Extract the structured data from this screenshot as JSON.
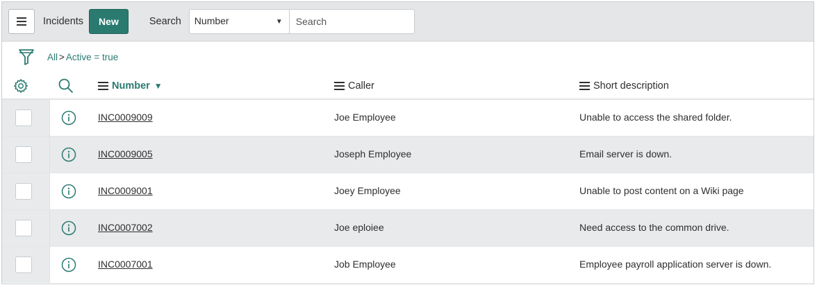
{
  "topbar": {
    "title": "Incidents",
    "new_label": "New",
    "search_label": "Search",
    "field_value": "Number",
    "search_placeholder": "Search"
  },
  "filter": {
    "crumb_all": "All",
    "separator": ">",
    "crumb_condition": "Active = true"
  },
  "columns": {
    "number": "Number",
    "caller": "Caller",
    "short_description": "Short description",
    "sorted_column": "Number",
    "sort_direction": "descending"
  },
  "rows": [
    {
      "number": "INC0009009",
      "caller": "Joe Employee",
      "short_description": "Unable to access the shared folder."
    },
    {
      "number": "INC0009005",
      "caller": "Joseph Employee",
      "short_description": "Email server is down."
    },
    {
      "number": "INC0009001",
      "caller": "Joey Employee",
      "short_description": "Unable to post content on a Wiki page"
    },
    {
      "number": "INC0007002",
      "caller": "Joe eploiee",
      "short_description": "Need access to the common drive."
    },
    {
      "number": "INC0007001",
      "caller": "Job Employee",
      "short_description": "Employee payroll application server is down."
    }
  ],
  "icons": {
    "menu": "hamburger-icon",
    "filter": "funnel-icon",
    "settings": "gear-icon",
    "search": "search-icon",
    "row_info": "info-icon",
    "sort": "sort-down-arrow"
  },
  "colors": {
    "accent": "#2a7a70",
    "topbar_bg": "#e4e6e7",
    "alt_row_bg": "#e8eaeb"
  }
}
